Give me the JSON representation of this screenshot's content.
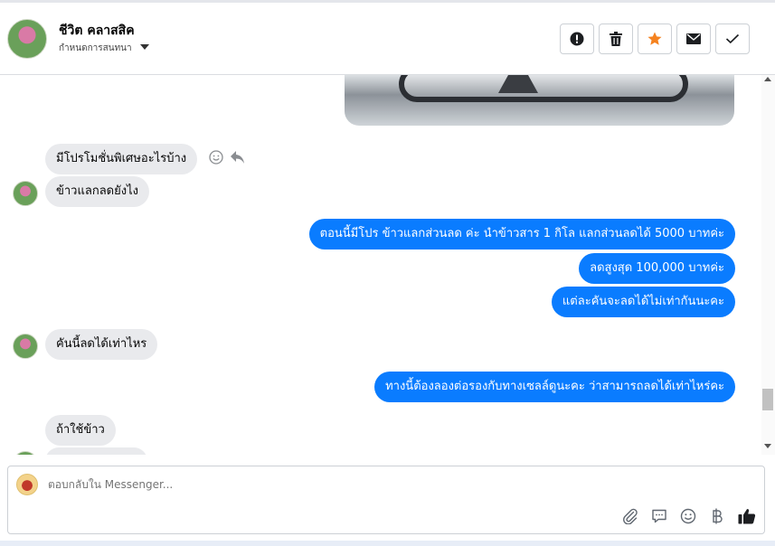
{
  "header": {
    "name": "ชีวิต คลาสสิค",
    "subtitle": "กำหนดการสนทนา",
    "buttons": [
      {
        "name": "mark-spam-button",
        "icon": "exclamation-icon"
      },
      {
        "name": "delete-button",
        "icon": "trash-icon"
      },
      {
        "name": "star-button",
        "icon": "star-icon",
        "color": "#f5821f"
      },
      {
        "name": "mark-unread-button",
        "icon": "envelope-icon"
      },
      {
        "name": "mark-done-button",
        "icon": "check-icon"
      }
    ]
  },
  "messages": [
    {
      "direction": "in",
      "text": "มีโปรโมชั่นพิเศษอะไรบ้าง"
    },
    {
      "direction": "in",
      "text": "ข้าวแลกลดยังไง"
    },
    {
      "direction": "out",
      "text": "ตอนนี้มีโปร ข้าวแลกส่วนลด ค่ะ นำข้าวสาร 1 กิโล แลกส่วนลดได้ 5000 บาทค่ะ"
    },
    {
      "direction": "out",
      "text": "ลดสูงสุด 100,000 บาทค่ะ"
    },
    {
      "direction": "out",
      "text": "แต่ละคันจะลดได้ไม่เท่ากันนะคะ"
    },
    {
      "direction": "in",
      "text": "คันนี้ลดได้เท่าไหร"
    },
    {
      "direction": "out",
      "text": "ทางนี้ต้องลองต่อรองกับทางเซลล์ดูนะคะ ว่าสามารถลดได้เท่าไหร่คะ"
    },
    {
      "direction": "in",
      "text": "ถ้าใช้ข้าว"
    }
  ],
  "composer": {
    "placeholder": "ตอบกลับใน Messenger...",
    "tools": [
      "paperclip-icon",
      "saved-reply-icon",
      "emoji-icon",
      "baht-icon",
      "thumbs-up-icon"
    ]
  },
  "colors": {
    "outgoing_bubble": "#0a7cff",
    "incoming_bubble": "#e9eaed",
    "accent_star": "#f5821f"
  }
}
